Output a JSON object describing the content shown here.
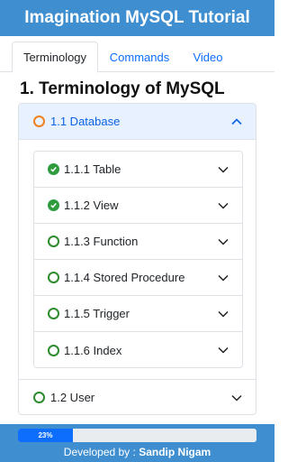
{
  "app_title": "Imagination MySQL Tutorial",
  "tabs": [
    {
      "label": "Terminology",
      "active": true
    },
    {
      "label": "Commands",
      "active": false
    },
    {
      "label": "Video",
      "active": false
    }
  ],
  "page_title": "1. Terminology of MySQL",
  "sections": [
    {
      "label": "1.1 Database",
      "expanded": true,
      "status_icon": "orange-circle-icon",
      "items": [
        {
          "label": "1.1.1 Table",
          "completed": true
        },
        {
          "label": "1.1.2 View",
          "completed": true
        },
        {
          "label": "1.1.3 Function",
          "completed": false
        },
        {
          "label": "1.1.4 Stored Procedure",
          "completed": false
        },
        {
          "label": "1.1.5 Trigger",
          "completed": false
        },
        {
          "label": "1.1.6 Index",
          "completed": false
        }
      ]
    },
    {
      "label": "1.2 User",
      "expanded": false,
      "status_icon": "green-circle-icon",
      "items": []
    }
  ],
  "progress": {
    "label": "23%",
    "value": 0.23
  },
  "footer": {
    "prefix": "Developed by : ",
    "author": "Sandip Nigam"
  },
  "colors": {
    "brand": "#3f8fd0",
    "progress": "#0d6efd",
    "done": "#2e9b3e",
    "pending": "#2e8b2e",
    "active_section": "#f0821e"
  }
}
